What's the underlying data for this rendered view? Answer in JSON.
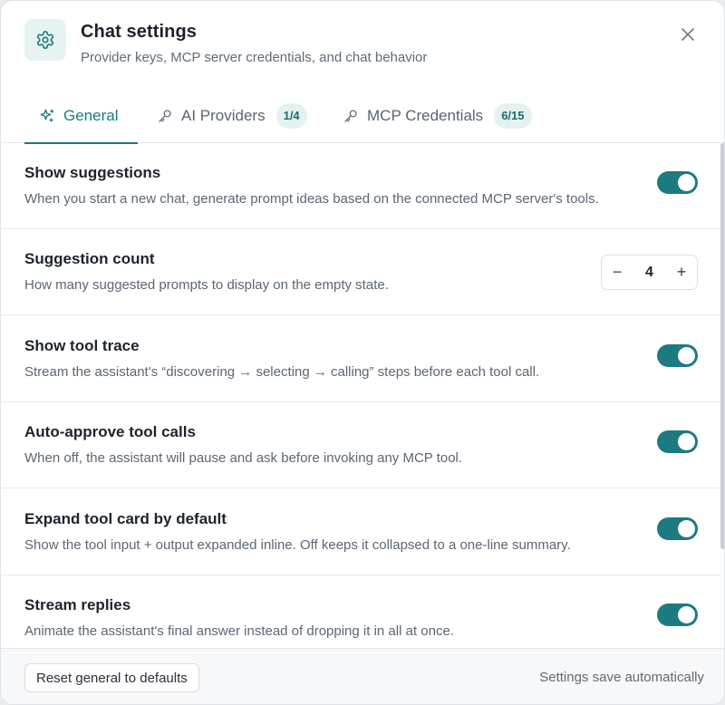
{
  "header": {
    "title": "Chat settings",
    "subtitle": "Provider keys, MCP server credentials, and chat behavior",
    "icon": "gear-icon",
    "close_icon": "close-icon"
  },
  "tabs": [
    {
      "label": "General",
      "icon": "sparkles-icon",
      "active": true
    },
    {
      "label": "AI Providers",
      "icon": "key-icon",
      "badge": "1/4"
    },
    {
      "label": "MCP Credentials",
      "icon": "key-icon",
      "badge": "6/15"
    }
  ],
  "settings": {
    "show_suggestions": {
      "title": "Show suggestions",
      "description": "When you start a new chat, generate prompt ideas based on the connected MCP server's tools.",
      "enabled": true
    },
    "suggestion_count": {
      "title": "Suggestion count",
      "description": "How many suggested prompts to display on the empty state.",
      "value": "4",
      "decrement": "−",
      "increment": "+"
    },
    "show_tool_trace": {
      "title": "Show tool trace",
      "description": "Stream the assistant's “discovering → selecting → calling” steps before each tool call.",
      "enabled": true
    },
    "auto_approve": {
      "title": "Auto-approve tool calls",
      "description": "When off, the assistant will pause and ask before invoking any MCP tool.",
      "enabled": true
    },
    "expand_tool_card": {
      "title": "Expand tool card by default",
      "description": "Show the tool input + output expanded inline. Off keeps it collapsed to a one-line summary.",
      "enabled": true
    },
    "stream_replies": {
      "title": "Stream replies",
      "description": "Animate the assistant's final answer instead of dropping it in all at once.",
      "enabled": true
    }
  },
  "footer": {
    "reset_label": "Reset general to defaults",
    "status": "Settings save automatically"
  },
  "colors": {
    "accent": "#1d7a80",
    "badge_bg": "#e4f1f1",
    "icon_bg": "#e6f3f3"
  }
}
